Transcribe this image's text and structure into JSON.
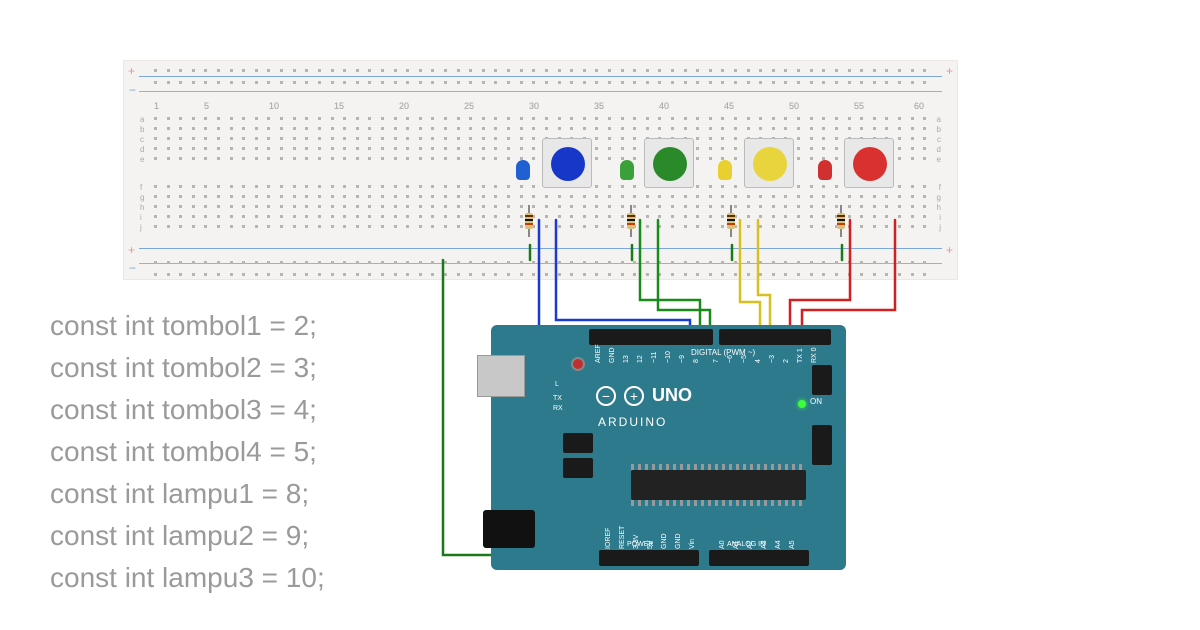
{
  "breadboard": {
    "col_labels": [
      "1",
      "5",
      "10",
      "15",
      "20",
      "25",
      "30",
      "35",
      "40",
      "45",
      "50",
      "55",
      "60"
    ],
    "row_labels_left": [
      "a",
      "b",
      "c",
      "d",
      "e",
      "f",
      "g",
      "h",
      "i",
      "j"
    ],
    "row_labels_right": [
      "a",
      "b",
      "c",
      "d",
      "e",
      "f",
      "g",
      "h",
      "i",
      "j"
    ]
  },
  "components": {
    "buttons": [
      {
        "color": "blue",
        "name": "button-blue"
      },
      {
        "color": "green",
        "name": "button-green"
      },
      {
        "color": "yellow",
        "name": "button-yellow"
      },
      {
        "color": "red",
        "name": "button-red"
      }
    ],
    "leds": [
      {
        "color": "blue",
        "name": "led-blue"
      },
      {
        "color": "green",
        "name": "led-green"
      },
      {
        "color": "yellow",
        "name": "led-yellow"
      },
      {
        "color": "red",
        "name": "led-red"
      }
    ],
    "resistors": [
      {
        "bands": [
          "#603000",
          "#101010",
          "#c04000"
        ],
        "name": "resistor-1"
      },
      {
        "bands": [
          "#603000",
          "#101010",
          "#c04000"
        ],
        "name": "resistor-2"
      },
      {
        "bands": [
          "#603000",
          "#101010",
          "#c04000"
        ],
        "name": "resistor-3"
      },
      {
        "bands": [
          "#603000",
          "#101010",
          "#c04000"
        ],
        "name": "resistor-4"
      }
    ]
  },
  "arduino": {
    "brand_symbol": "∞",
    "brand_text": "UNO",
    "brand_sub": "ARDUINO",
    "on_label": "ON",
    "digital_label": "DIGITAL (PWM ~)",
    "power_label": "POWER",
    "analog_label": "ANALOG IN",
    "tx_label": "TX",
    "rx_label": "RX",
    "l_label": "L",
    "top_pins": [
      "AREF",
      "GND",
      "13",
      "12",
      "~11",
      "~10",
      "~9",
      "8",
      "7",
      "~6",
      "~5",
      "4",
      "~3",
      "2",
      "TX 1",
      "RX 0"
    ],
    "bottom_pins": [
      "IOREF",
      "RESET",
      "3.3V",
      "5V",
      "GND",
      "GND",
      "Vin",
      "A0",
      "A1",
      "A2",
      "A3",
      "A4",
      "A5"
    ]
  },
  "wires": {
    "colors": {
      "gnd_left": "#1a7a1a",
      "gnd_right": "#1a7a1a",
      "blue1": "#1a3ad0",
      "blue2": "#1a3ad0",
      "green1": "#1a8a1a",
      "green2": "#1a8a1a",
      "yellow1": "#d8c020",
      "yellow2": "#d8c020",
      "red1": "#d02020",
      "red2": "#d02020"
    }
  },
  "code_lines": [
    "const int tombol1 = 2;",
    "const int tombol2 = 3;",
    "const int tombol3 = 4;",
    "const int tombol4 = 5;",
    "const int lampu1 = 8;",
    "const int lampu2 = 9;",
    "const int lampu3 = 10;"
  ]
}
